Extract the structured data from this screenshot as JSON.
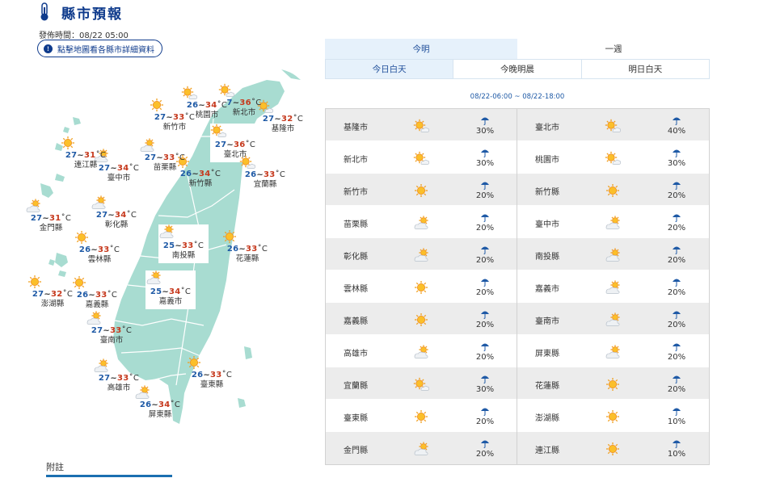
{
  "header": {
    "title": "縣市預報",
    "icon": "thermometer-icon"
  },
  "issue": {
    "label": "發佈時間：08/22 05:00"
  },
  "map_hint": {
    "label": "點擊地圖看各縣市詳細資料",
    "icon": "info-icon"
  },
  "map": {
    "cities": [
      {
        "name": "基隆市",
        "lo": "27",
        "hi": "32",
        "unit": "˚C",
        "icon": "sun-cloud"
      },
      {
        "name": "臺北市",
        "lo": "27",
        "hi": "36",
        "unit": "˚C",
        "icon": "sun-cloud"
      },
      {
        "name": "新北市",
        "lo": "7",
        "hi": "36",
        "unit": "˚C",
        "icon": "sun-cloud"
      },
      {
        "name": "桃園市",
        "lo": "26",
        "hi": "34",
        "unit": "˚C",
        "icon": "sun-cloud"
      },
      {
        "name": "新竹市",
        "lo": "27",
        "hi": "33",
        "unit": "˚C",
        "icon": "sun"
      },
      {
        "name": "新竹縣",
        "lo": "26",
        "hi": "34",
        "unit": "˚C",
        "icon": "sun"
      },
      {
        "name": "苗栗縣",
        "lo": "27",
        "hi": "33",
        "unit": "˚C",
        "icon": "cloud-sun"
      },
      {
        "name": "臺中市",
        "lo": "27",
        "hi": "34",
        "unit": "˚C",
        "icon": "cloud-sun"
      },
      {
        "name": "彰化縣",
        "lo": "27",
        "hi": "34",
        "unit": "˚C",
        "icon": "cloud-sun"
      },
      {
        "name": "南投縣",
        "lo": "25",
        "hi": "33",
        "unit": "˚C",
        "icon": "cloud-sun"
      },
      {
        "name": "雲林縣",
        "lo": "26",
        "hi": "33",
        "unit": "˚C",
        "icon": "sun"
      },
      {
        "name": "嘉義市",
        "lo": "25",
        "hi": "34",
        "unit": "˚C",
        "icon": "cloud-sun"
      },
      {
        "name": "嘉義縣",
        "lo": "26",
        "hi": "33",
        "unit": "˚C",
        "icon": "sun"
      },
      {
        "name": "臺南市",
        "lo": "27",
        "hi": "33",
        "unit": "˚C",
        "icon": "cloud-sun"
      },
      {
        "name": "高雄市",
        "lo": "27",
        "hi": "33",
        "unit": "˚C",
        "icon": "cloud-sun"
      },
      {
        "name": "屏東縣",
        "lo": "26",
        "hi": "34",
        "unit": "˚C",
        "icon": "cloud-sun"
      },
      {
        "name": "宜蘭縣",
        "lo": "26",
        "hi": "33",
        "unit": "˚C",
        "icon": "sun-cloud"
      },
      {
        "name": "花蓮縣",
        "lo": "26",
        "hi": "33",
        "unit": "˚C",
        "icon": "sun"
      },
      {
        "name": "臺東縣",
        "lo": "26",
        "hi": "33",
        "unit": "˚C",
        "icon": "sun"
      },
      {
        "name": "澎湖縣",
        "lo": "27",
        "hi": "32",
        "unit": "˚C",
        "icon": "sun"
      },
      {
        "name": "金門縣",
        "lo": "27",
        "hi": "31",
        "unit": "˚C",
        "icon": "cloud-sun"
      },
      {
        "name": "連江縣",
        "lo": "27",
        "hi": "31",
        "unit": "˚C",
        "icon": "sun"
      }
    ]
  },
  "footnote": {
    "label": "附註"
  },
  "tabs": {
    "today": "今明",
    "week": "一週"
  },
  "subtabs": {
    "day": "今日白天",
    "night": "今晚明晨",
    "tomorrow": "明日白天"
  },
  "period": "08/22-06:00 ~ 08/22-18:00",
  "table": {
    "rows": [
      [
        {
          "name": "基隆市",
          "icon": "sun-cloud",
          "pop": "30%"
        },
        {
          "name": "臺北市",
          "icon": "sun-cloud",
          "pop": "40%"
        }
      ],
      [
        {
          "name": "新北市",
          "icon": "sun-cloud",
          "pop": "30%"
        },
        {
          "name": "桃園市",
          "icon": "sun-cloud",
          "pop": "30%"
        }
      ],
      [
        {
          "name": "新竹市",
          "icon": "sun",
          "pop": "20%"
        },
        {
          "name": "新竹縣",
          "icon": "sun",
          "pop": "20%"
        }
      ],
      [
        {
          "name": "苗栗縣",
          "icon": "cloud-sun",
          "pop": "20%"
        },
        {
          "name": "臺中市",
          "icon": "cloud-sun",
          "pop": "20%"
        }
      ],
      [
        {
          "name": "彰化縣",
          "icon": "cloud-sun",
          "pop": "20%"
        },
        {
          "name": "南投縣",
          "icon": "cloud-sun",
          "pop": "20%"
        }
      ],
      [
        {
          "name": "雲林縣",
          "icon": "sun",
          "pop": "20%"
        },
        {
          "name": "嘉義市",
          "icon": "cloud-sun",
          "pop": "20%"
        }
      ],
      [
        {
          "name": "嘉義縣",
          "icon": "sun",
          "pop": "20%"
        },
        {
          "name": "臺南市",
          "icon": "cloud-sun",
          "pop": "20%"
        }
      ],
      [
        {
          "name": "高雄市",
          "icon": "cloud-sun",
          "pop": "20%"
        },
        {
          "name": "屏東縣",
          "icon": "cloud-sun",
          "pop": "20%"
        }
      ],
      [
        {
          "name": "宜蘭縣",
          "icon": "sun-cloud",
          "pop": "30%"
        },
        {
          "name": "花蓮縣",
          "icon": "sun",
          "pop": "20%"
        }
      ],
      [
        {
          "name": "臺東縣",
          "icon": "sun",
          "pop": "20%"
        },
        {
          "name": "澎湖縣",
          "icon": "sun",
          "pop": "10%"
        }
      ],
      [
        {
          "name": "金門縣",
          "icon": "cloud-sun",
          "pop": "20%"
        },
        {
          "name": "連江縣",
          "icon": "sun",
          "pop": "10%"
        }
      ]
    ]
  },
  "colors": {
    "accent": "#0f3b8c",
    "map_fill": "#a8dcd1",
    "low_temp": "#1f5aa6",
    "high_temp": "#c6391d",
    "umbrella": "#1f5aa6"
  }
}
